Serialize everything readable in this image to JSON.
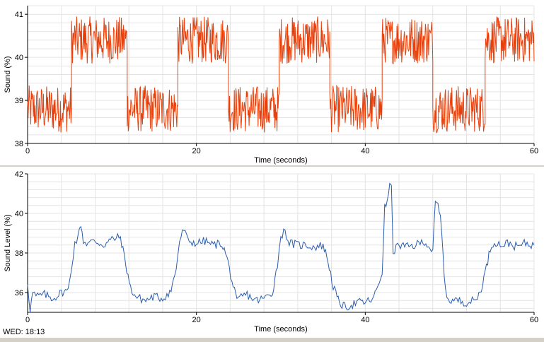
{
  "status_text": "WED: 18:13",
  "chart_data": [
    {
      "type": "line",
      "title": "",
      "xlabel": "Time (seconds)",
      "ylabel": "Sound (%)",
      "xlim": [
        0,
        60
      ],
      "ylim": [
        38,
        41.2
      ],
      "xticks": [
        0,
        20,
        40,
        60
      ],
      "yticks": [
        38,
        39,
        40,
        41
      ],
      "grid": true,
      "series": [
        {
          "color": "#e8400c",
          "style": "square-wave-with-noise",
          "low_level": 38.8,
          "high_level": 40.4,
          "noise_amplitude": 0.55,
          "segments": [
            {
              "x_start": 0,
              "x_end": 5.2,
              "level": "low"
            },
            {
              "x_start": 5.2,
              "x_end": 11.8,
              "level": "high"
            },
            {
              "x_start": 11.8,
              "x_end": 17.8,
              "level": "low"
            },
            {
              "x_start": 17.8,
              "x_end": 23.8,
              "level": "high"
            },
            {
              "x_start": 23.8,
              "x_end": 29.8,
              "level": "low"
            },
            {
              "x_start": 29.8,
              "x_end": 35.8,
              "level": "high"
            },
            {
              "x_start": 35.8,
              "x_end": 42.0,
              "level": "low"
            },
            {
              "x_start": 42.0,
              "x_end": 48.0,
              "level": "high"
            },
            {
              "x_start": 48.0,
              "x_end": 54.2,
              "level": "low"
            },
            {
              "x_start": 54.2,
              "x_end": 60,
              "level": "high"
            }
          ]
        }
      ]
    },
    {
      "type": "line",
      "title": "",
      "xlabel": "Time (seconds)",
      "ylabel": "Sound Level (%)",
      "xlim": [
        0,
        60
      ],
      "ylim": [
        35,
        42
      ],
      "xticks": [
        0,
        20,
        40,
        60
      ],
      "yticks": [
        36,
        38,
        40,
        42
      ],
      "grid": true,
      "series": [
        {
          "color": "#2a5db0",
          "x": [
            0,
            0.3,
            0.6,
            1,
            2,
            3,
            4,
            4.8,
            5.2,
            5.6,
            6.0,
            6.3,
            6.6,
            7,
            8,
            9,
            10,
            11,
            11.6,
            12.2,
            12.8,
            13.3,
            14,
            15,
            16,
            17,
            17.6,
            18.0,
            18.5,
            19,
            20,
            21,
            22,
            23,
            23.6,
            24.2,
            24.8,
            25.3,
            26,
            27,
            28,
            29,
            29.6,
            30.0,
            30.5,
            31,
            32,
            33,
            34,
            35,
            35.6,
            36.2,
            36.8,
            37.4,
            38,
            39,
            40,
            41,
            42.0,
            42.3,
            42.6,
            42.9,
            43.1,
            43.3,
            44,
            45,
            46,
            47,
            48.0,
            48.3,
            48.6,
            48.9,
            49.2,
            49.5,
            50,
            51,
            52,
            53,
            53.6,
            54.2,
            54.8,
            55.3,
            56,
            57,
            58,
            59,
            60
          ],
          "y": [
            36.5,
            35.1,
            36.0,
            35.8,
            35.9,
            35.7,
            36.0,
            36.1,
            37.3,
            38.5,
            38.8,
            39.5,
            38.6,
            38.5,
            38.6,
            38.4,
            38.7,
            38.8,
            37.5,
            36.2,
            35.8,
            35.7,
            35.6,
            35.8,
            35.7,
            36.1,
            37.2,
            38.6,
            39.2,
            38.6,
            38.5,
            38.6,
            38.4,
            38.5,
            37.8,
            36.6,
            35.5,
            35.8,
            35.9,
            35.6,
            35.7,
            36.0,
            37.4,
            38.9,
            39.1,
            38.5,
            38.4,
            38.4,
            38.3,
            38.4,
            37.6,
            36.3,
            35.6,
            35.3,
            35.3,
            35.5,
            35.5,
            35.7,
            37.0,
            40.3,
            40.5,
            41.6,
            41.2,
            38.1,
            38.4,
            38.3,
            38.4,
            38.6,
            38.1,
            40.5,
            40.4,
            39.8,
            38.1,
            36.0,
            35.6,
            35.6,
            35.5,
            35.6,
            36.0,
            37.0,
            38.2,
            38.6,
            38.4,
            38.5,
            38.3,
            38.5,
            38.4
          ]
        }
      ]
    }
  ]
}
